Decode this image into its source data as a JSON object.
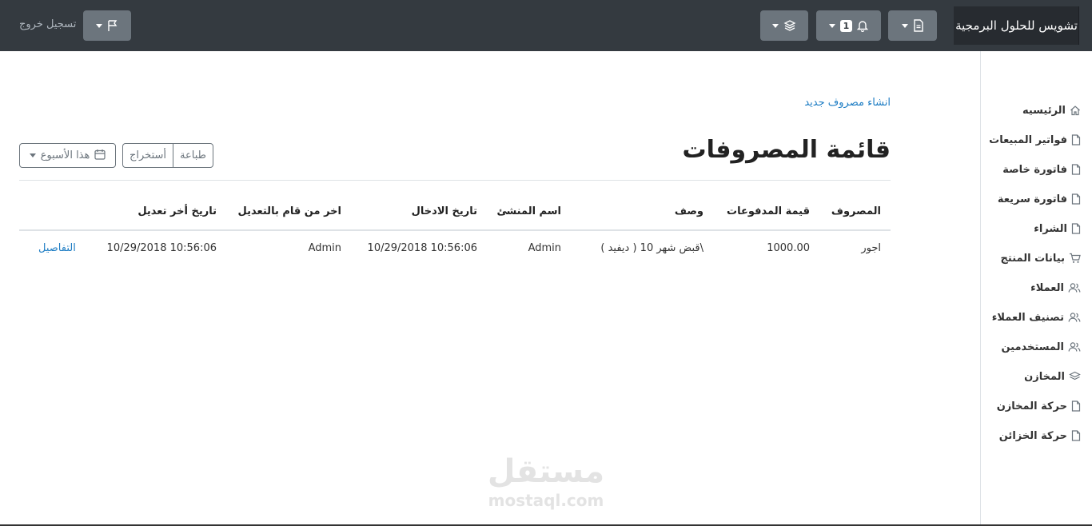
{
  "navbar": {
    "brand": "تشويس للحلول البرمجية",
    "documents_icon": "file-icon",
    "notifications_count": "1",
    "notifications_icon": "bell-icon",
    "layers_icon": "layers-icon",
    "flag_icon": "flag-icon",
    "logout_label": "تسجيل خروج"
  },
  "sidebar": {
    "items": [
      {
        "label": "الرئيسيه",
        "icon": "home-icon"
      },
      {
        "label": "فواتير المبيعات",
        "icon": "file-icon"
      },
      {
        "label": "فاتورة خاصة",
        "icon": "file-icon"
      },
      {
        "label": "فاتورة سريعة",
        "icon": "file-icon"
      },
      {
        "label": "الشراء",
        "icon": "file-icon"
      },
      {
        "label": "بيانات المنتج",
        "icon": "cart-icon"
      },
      {
        "label": "العملاء",
        "icon": "users-icon"
      },
      {
        "label": "تصنيف العملاء",
        "icon": "users-icon"
      },
      {
        "label": "المستخدمين",
        "icon": "users-icon"
      },
      {
        "label": "المخازن",
        "icon": "layers-icon"
      },
      {
        "label": "حركة المخازن",
        "icon": "file-icon"
      },
      {
        "label": "حركة الخزائن",
        "icon": "file-icon"
      }
    ]
  },
  "main": {
    "create_link": "انشاء مصروف جديد",
    "title": "قائمة المصروفات",
    "print_label": "طباعة",
    "export_label": "أستخراج",
    "range_label": "هذا الأسبوع"
  },
  "table": {
    "headers": {
      "expense": "المصروف",
      "amount": "قيمة المدفوعات",
      "description": "وصف",
      "creator": "اسم المنشئ",
      "entry_date": "تاريخ الادخال",
      "last_editor": "اخر من قام بالتعديل",
      "last_edit_date": "تاريخ أخر تعديل"
    },
    "rows": [
      {
        "expense": "اجور",
        "amount": "1000.00",
        "description": "قبض شهر 10 ( ديفيد )\\",
        "creator": "Admin",
        "entry_date": "10/29/2018 10:56:06",
        "last_editor": "Admin",
        "last_edit_date": "10/29/2018 10:56:06",
        "details": "التفاصيل"
      }
    ]
  },
  "watermark": {
    "arabic": "مستقل",
    "latin": "mostaql.com"
  },
  "colors": {
    "navbar": "#343a40",
    "button": "#6c757d",
    "link": "#1e7dc4"
  }
}
